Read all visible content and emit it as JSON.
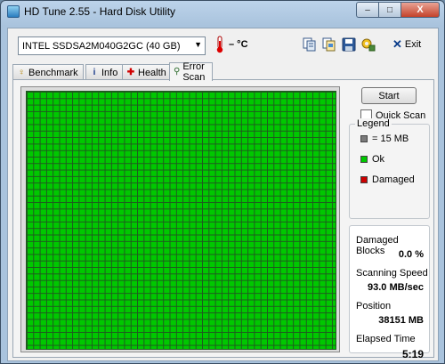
{
  "window": {
    "title": "HD Tune 2.55 - Hard Disk Utility",
    "buttons": {
      "minimize": "–",
      "maximize": "□",
      "close": "X"
    }
  },
  "toolbar": {
    "drive": "INTEL SSDSA2M040G2GC (40 GB)",
    "temperature": "– °C",
    "exit_label": "Exit",
    "tools": [
      "copy-info-icon",
      "copy-screen-icon",
      "save-icon",
      "options-icon"
    ]
  },
  "tabs": [
    {
      "label": "Benchmark",
      "icon": "benchmark-icon"
    },
    {
      "label": "Info",
      "icon": "info-icon"
    },
    {
      "label": "Health",
      "icon": "health-icon"
    },
    {
      "label": "Error Scan",
      "icon": "magnifier-icon",
      "active": true
    }
  ],
  "scan": {
    "start_label": "Start",
    "quick_scan_label": "Quick Scan",
    "quick_scan_checked": false,
    "block_color": "#00c800"
  },
  "legend": {
    "title": "Legend",
    "items": [
      {
        "label": "= 15 MB",
        "color": "#7a7a7a"
      },
      {
        "label": "Ok",
        "color": "#00c800"
      },
      {
        "label": "Damaged",
        "color": "#cc0000"
      }
    ]
  },
  "stats": {
    "damaged_blocks_label": "Damaged Blocks",
    "damaged_blocks_value": "0.0 %",
    "scanning_speed_label": "Scanning Speed",
    "scanning_speed_value": "93.0 MB/sec",
    "position_label": "Position",
    "position_value": "38151 MB",
    "elapsed_time_label": "Elapsed Time",
    "elapsed_time_value": "5:19"
  }
}
